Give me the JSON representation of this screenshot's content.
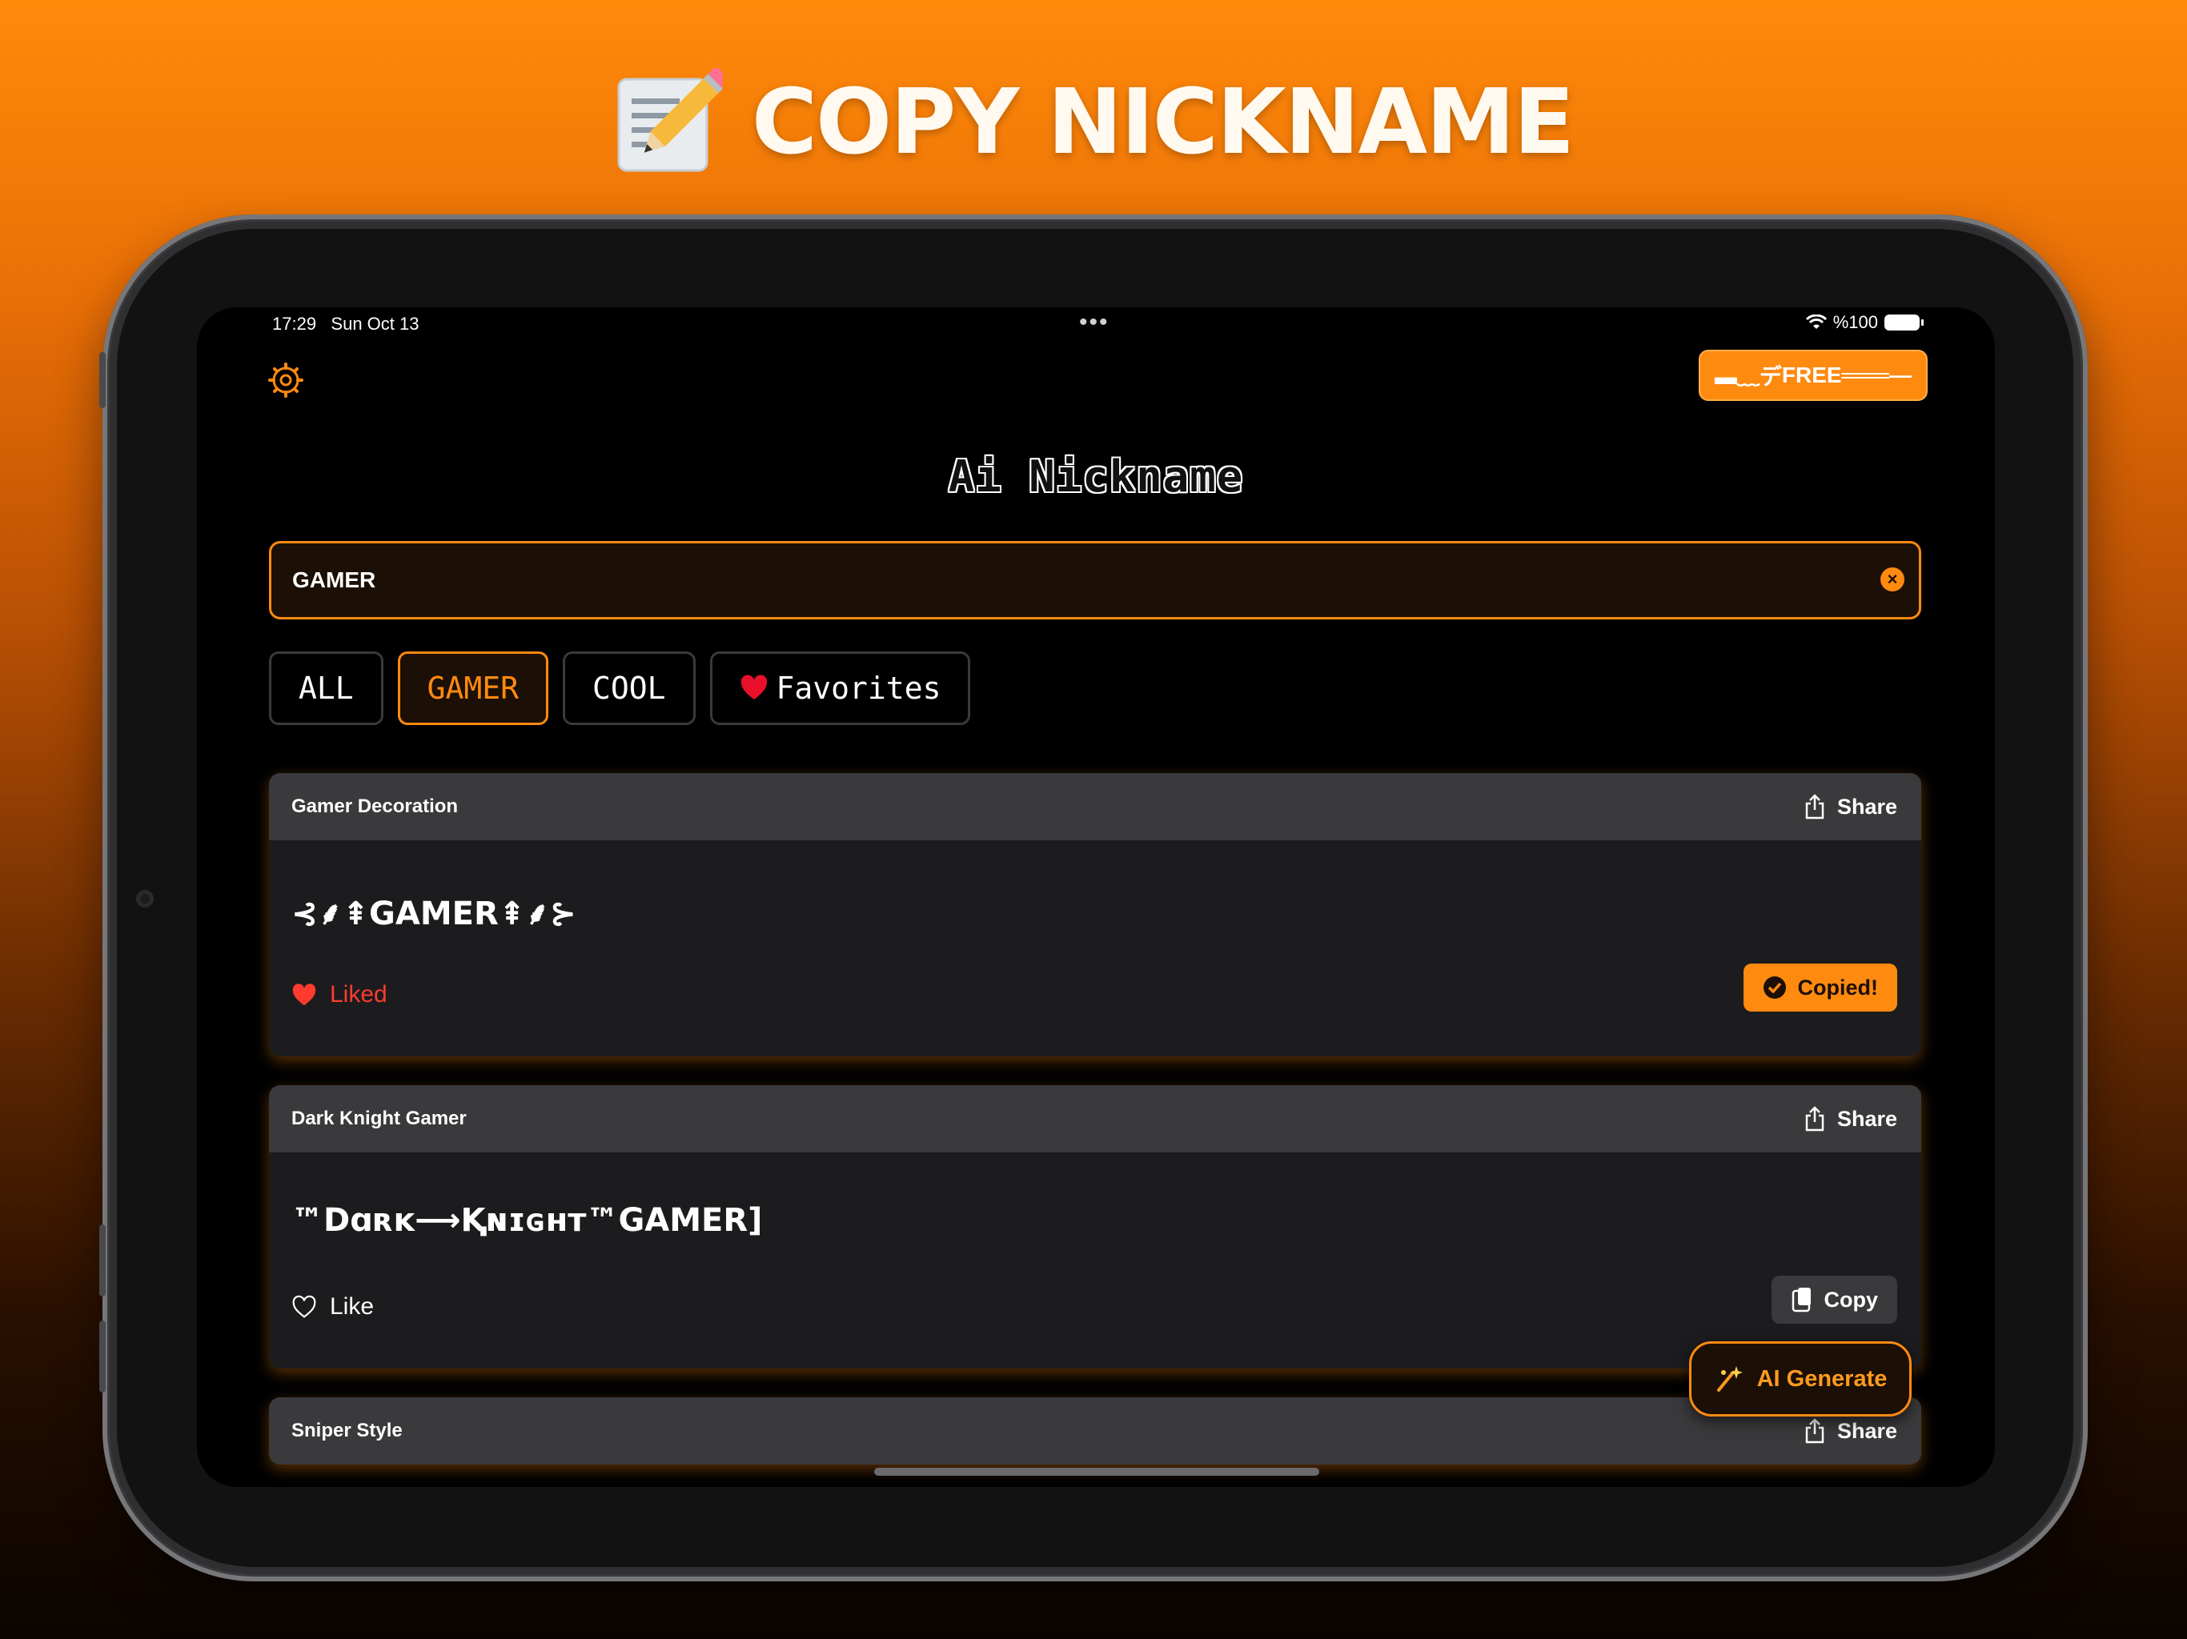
{
  "hero": {
    "title": "COPY NICKNAME",
    "icon": "memo-pencil-icon"
  },
  "status_bar": {
    "time": "17:29",
    "date": "Sun Oct 13",
    "battery": "%100"
  },
  "header": {
    "free_label": "FREE",
    "free_decor_left": "▬﹏デ",
    "free_decor_right": "═══—",
    "app_title": "Ai Nickname"
  },
  "search": {
    "value": "GAMER",
    "placeholder": ""
  },
  "tabs": [
    {
      "label": "ALL",
      "active": false
    },
    {
      "label": "GAMER",
      "active": true
    },
    {
      "label": "COOL",
      "active": false
    },
    {
      "label": "Favorites",
      "active": false
    }
  ],
  "cards": [
    {
      "title": "Gamer Decoration",
      "share": "Share",
      "nickname": "⊰⸙⇞GAMER⇞⸙⊱",
      "like": "Liked",
      "liked": true,
      "copy": "Copied!",
      "copied": true
    },
    {
      "title": "Dark Knight Gamer",
      "share": "Share",
      "nickname": "™Dɑʀᴋ⟶Ⱪɴɪɢʜᴛ™GAMER]",
      "like": "Like",
      "liked": false,
      "copy": "Copy",
      "copied": false
    },
    {
      "title": "Sniper Style",
      "share": "Share"
    }
  ],
  "ai_button": {
    "label": "AI Generate"
  },
  "colors": {
    "accent": "#ff8a10",
    "liked": "#ff3b30",
    "card": "#1c1c1e",
    "card_head": "#3a3a3c"
  }
}
